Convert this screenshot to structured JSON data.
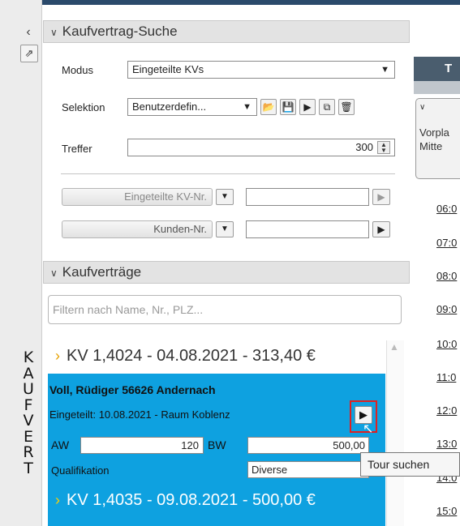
{
  "sidebar": {
    "collapse_glyph": "‹",
    "export_glyph": "⇗",
    "vertical_title_letters": [
      "K",
      "A",
      "U",
      "F",
      "V",
      "E",
      "R",
      "T"
    ]
  },
  "search_section": {
    "title": "Kaufvertrag-Suche",
    "modus_label": "Modus",
    "modus_value": "Eingeteilte KVs",
    "selektion_label": "Selektion",
    "selektion_value": "Benutzerdefin...",
    "treffer_label": "Treffer",
    "treffer_value": "300",
    "kvnr_button": "Eingeteilte KV-Nr.",
    "kunden_button": "Kunden-Nr."
  },
  "contracts_section": {
    "title": "Kaufverträge",
    "filter_placeholder": "Filtern nach Name, Nr., PLZ...",
    "items": [
      {
        "label": "KV 1,4024 - 04.08.2021 - 313,40 €"
      },
      {
        "label": "KV 1,4035 - 09.08.2021 - 500,00 €"
      }
    ],
    "selected": {
      "name": "Voll, Rüdiger 56626 Andernach",
      "eingeteilt": "Eingeteilt: 10.08.2021 - Raum Koblenz",
      "aw_label": "AW",
      "aw_value": "120",
      "bw_label": "BW",
      "bw_value": "500,00",
      "qual_label": "Qualifikation",
      "qual_value": "Diverse"
    }
  },
  "right_panel": {
    "header_letter": "T",
    "card_line1": "Vorpla",
    "card_line2": "Mitte",
    "times": [
      "06:0",
      "07:0",
      "08:0",
      "09:0",
      "10:0",
      "11:0",
      "12:0",
      "13:0",
      "14:0",
      "15:0"
    ]
  },
  "tooltip": "Tour suchen",
  "colors": {
    "accent_blue": "#0ea1e0",
    "highlight_red": "#e02020",
    "arrow_orange": "#e6a100"
  }
}
